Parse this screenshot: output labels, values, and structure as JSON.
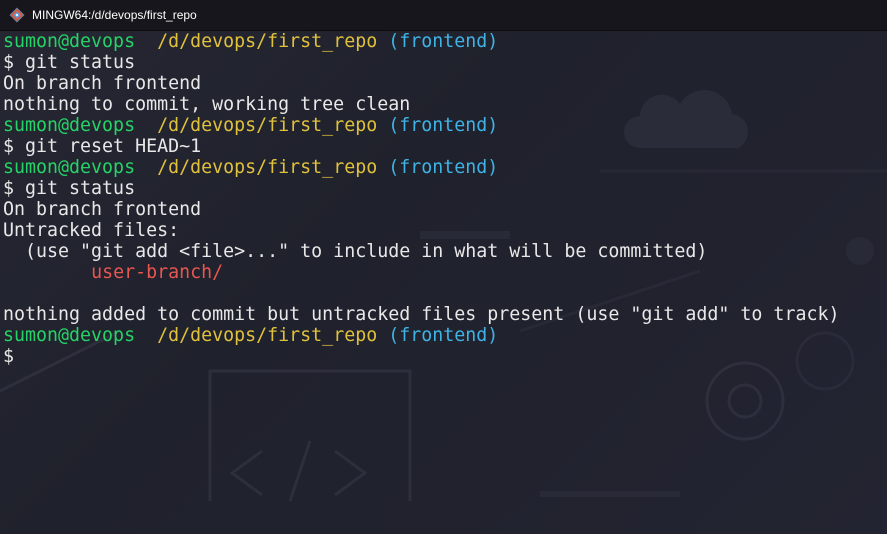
{
  "window": {
    "title": "MINGW64:/d/devops/first_repo"
  },
  "colors": {
    "prompt_user": "#25d366",
    "prompt_path": "#e0c13c",
    "prompt_branch": "#3fb3e6",
    "untracked": "#e85650",
    "text": "#e8e8e8",
    "background": "#23232d"
  },
  "icons": {
    "app": "git-bash-icon"
  },
  "terminal": {
    "lines": [
      {
        "type": "prompt",
        "user": "sumon@devops",
        "path": "/d/devops/first_repo",
        "branch": "(frontend)"
      },
      {
        "type": "text",
        "text": "$ git status"
      },
      {
        "type": "text",
        "text": "On branch frontend"
      },
      {
        "type": "text",
        "text": "nothing to commit, working tree clean"
      },
      {
        "type": "prompt",
        "user": "sumon@devops",
        "path": "/d/devops/first_repo",
        "branch": "(frontend)"
      },
      {
        "type": "text",
        "text": "$ git reset HEAD~1"
      },
      {
        "type": "prompt",
        "user": "sumon@devops",
        "path": "/d/devops/first_repo",
        "branch": "(frontend)"
      },
      {
        "type": "text",
        "text": "$ git status"
      },
      {
        "type": "text",
        "text": "On branch frontend"
      },
      {
        "type": "text",
        "text": "Untracked files:"
      },
      {
        "type": "text",
        "text": "  (use \"git add <file>...\" to include in what will be committed)"
      },
      {
        "type": "untracked",
        "indent": "        ",
        "text": "user-branch/"
      },
      {
        "type": "text",
        "text": ""
      },
      {
        "type": "text",
        "text": "nothing added to commit but untracked files present (use \"git add\" to track)"
      },
      {
        "type": "prompt",
        "user": "sumon@devops",
        "path": "/d/devops/first_repo",
        "branch": "(frontend)"
      },
      {
        "type": "text",
        "text": "$"
      }
    ]
  }
}
